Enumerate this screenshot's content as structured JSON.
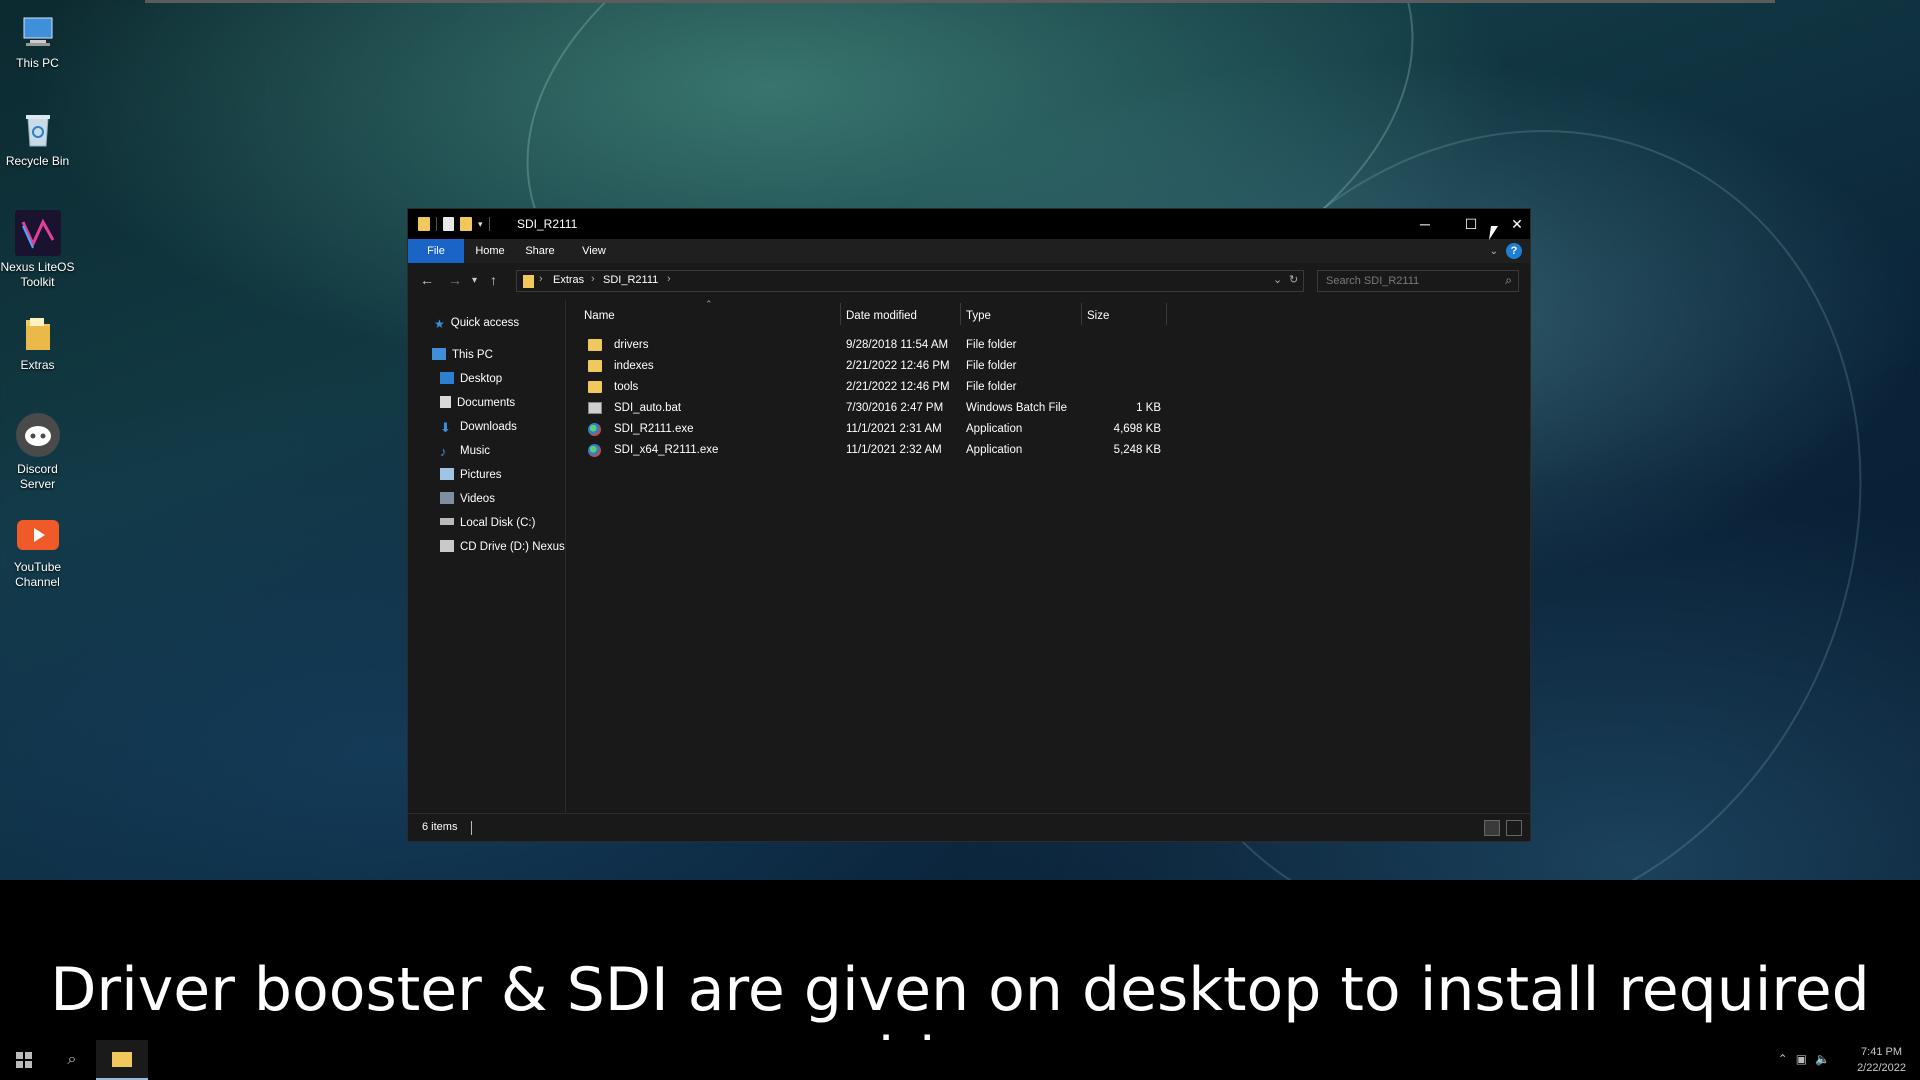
{
  "desktop": {
    "icons": [
      {
        "label": "This PC",
        "icon": "this-pc-icon"
      },
      {
        "label": "Recycle Bin",
        "icon": "recycle-bin-icon"
      },
      {
        "label": "Nexus LiteOS Toolkit",
        "icon": "nexus-toolkit-icon"
      },
      {
        "label": "Extras",
        "icon": "folder-icon"
      },
      {
        "label": "Discord Server",
        "icon": "discord-icon"
      },
      {
        "label": "YouTube Channel",
        "icon": "youtube-icon"
      }
    ]
  },
  "window": {
    "title": "SDI_R2111",
    "ribbon_tabs": [
      "File",
      "Home",
      "Share",
      "View"
    ],
    "address": {
      "crumbs": [
        "Extras",
        "SDI_R2111"
      ]
    },
    "search_placeholder": "Search SDI_R2111",
    "nav_pane": {
      "quick_access": "Quick access",
      "this_pc": "This PC",
      "items": [
        "Desktop",
        "Documents",
        "Downloads",
        "Music",
        "Pictures",
        "Videos",
        "Local Disk (C:)",
        "CD Drive (D:) Nexus"
      ]
    },
    "columns": {
      "name": "Name",
      "date": "Date modified",
      "type": "Type",
      "size": "Size"
    },
    "files": [
      {
        "name": "drivers",
        "date": "9/28/2018 11:54 AM",
        "type": "File folder",
        "size": "",
        "icon": "folder-icon"
      },
      {
        "name": "indexes",
        "date": "2/21/2022 12:46 PM",
        "type": "File folder",
        "size": "",
        "icon": "folder-icon"
      },
      {
        "name": "tools",
        "date": "2/21/2022 12:46 PM",
        "type": "File folder",
        "size": "",
        "icon": "folder-icon"
      },
      {
        "name": "SDI_auto.bat",
        "date": "7/30/2016 2:47 PM",
        "type": "Windows Batch File",
        "size": "1 KB",
        "icon": "batch-file-icon"
      },
      {
        "name": "SDI_R2111.exe",
        "date": "11/1/2021 2:31 AM",
        "type": "Application",
        "size": "4,698 KB",
        "icon": "exe-icon"
      },
      {
        "name": "SDI_x64_R2111.exe",
        "date": "11/1/2021 2:32 AM",
        "type": "Application",
        "size": "5,248 KB",
        "icon": "exe-icon"
      }
    ],
    "status": "6 items"
  },
  "caption": "Driver booster & SDI are given on desktop to install required drivers",
  "taskbar": {
    "time": "7:41 PM",
    "date": "2/22/2022"
  },
  "colors": {
    "accent": "#1a64c8",
    "folder": "#f1c85b",
    "window_bg": "#191919"
  }
}
